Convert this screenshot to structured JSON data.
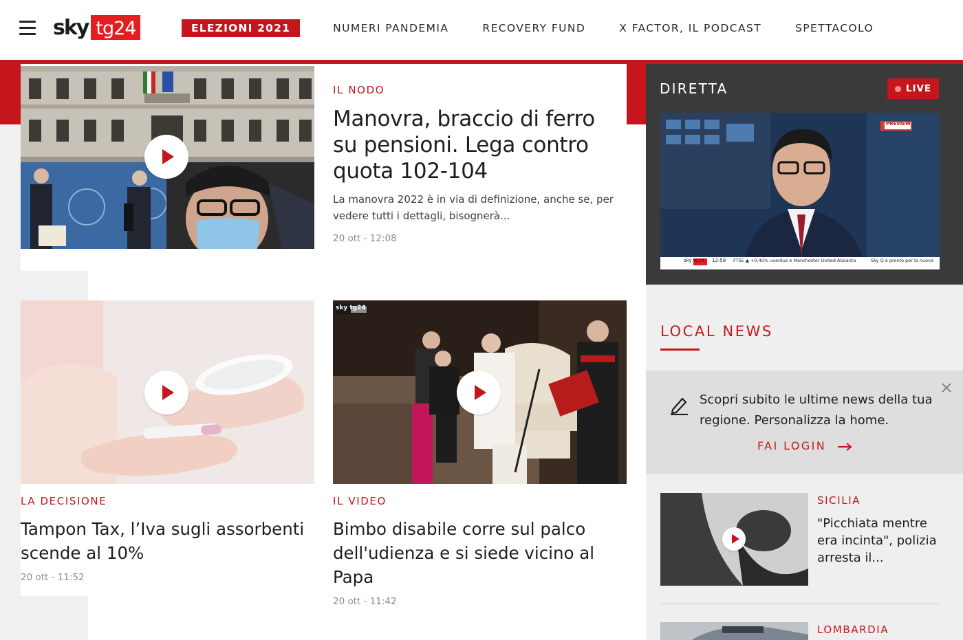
{
  "header": {
    "logo_sky": "sky",
    "logo_tg": "tg24",
    "nav": [
      {
        "label": "ELEZIONI 2021"
      },
      {
        "label": "NUMERI PANDEMIA"
      },
      {
        "label": "RECOVERY FUND"
      },
      {
        "label": "X FACTOR, IL PODCAST"
      },
      {
        "label": "SPETTACOLO"
      }
    ]
  },
  "top_story": {
    "kicker": "IL NODO",
    "headline": "Manovra, braccio di ferro su pensioni. Lega contro quota 102-104",
    "summary": "La manovra 2022 è in via di definizione, anche se, per vedere tutti i dettagli, bisognerà...",
    "timestamp": "20 ott - 12:08"
  },
  "stories": [
    {
      "kicker": "LA DECISIONE",
      "headline": "Tampon Tax, l’Iva sugli assorbenti scende al 10%",
      "timestamp": "20 ott - 11:52"
    },
    {
      "kicker": "IL VIDEO",
      "headline": "Bimbo disabile corre sul palco dell'udienza e si siede vicino al Papa",
      "timestamp": "20 ott - 11:42",
      "image_overlay": "sky tg24"
    }
  ],
  "diretta": {
    "title": "DIRETTA",
    "live_label": "LIVE",
    "video": {
      "preview_label": "PREVIEW",
      "ticker_logo": "sky tg24",
      "ticker_time": "12:58",
      "ticker_text": "FTSE ▲ +0,45% uventus e Manchester United-Atalanta",
      "ticker_right": "Sky Q è pronto per la nuova"
    }
  },
  "local_news": {
    "title": "LOCAL NEWS",
    "login_prompt": "Scopri subito le ultime news della tua regione. Personalizza la home.",
    "login_cta": "FAI LOGIN",
    "items": [
      {
        "region": "SICILIA",
        "headline": "\"Picchiata mentre era incinta\", polizia arresta il..."
      },
      {
        "region": "LOMBARDIA",
        "headline": ""
      }
    ]
  },
  "colors": {
    "accent_red": "#c4161c",
    "brand_red": "#e51d1f",
    "dark_panel": "#3a3a3a",
    "light_panel": "#efefef"
  },
  "icons": [
    "hamburger-menu-icon",
    "play-icon",
    "live-dot-icon",
    "pencil-icon",
    "arrow-right-icon",
    "close-icon"
  ]
}
